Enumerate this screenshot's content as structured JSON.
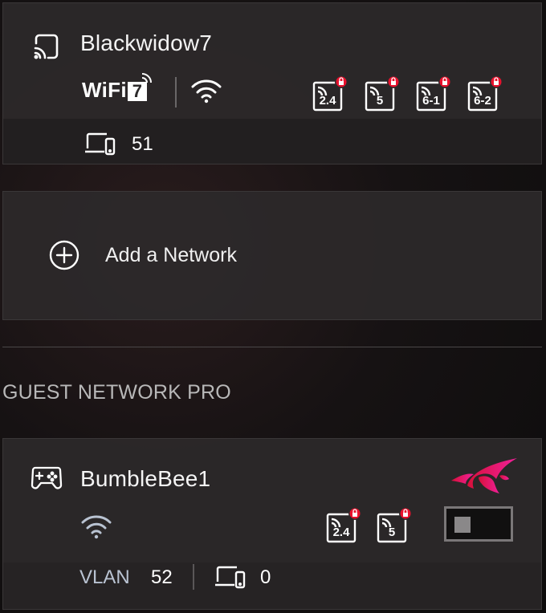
{
  "main_network": {
    "name": "Blackwidow7",
    "wifi_standard_label": "WiFi",
    "wifi_standard_number": "7",
    "bands": [
      "2.4",
      "5",
      "6-1",
      "6-2"
    ],
    "client_count": "51"
  },
  "add_network": {
    "label": "Add a Network"
  },
  "guest_section": {
    "title": "GUEST NETWORK PRO"
  },
  "guest_network": {
    "name": "BumbleBee1",
    "bands": [
      "2.4",
      "5"
    ],
    "vlan_label": "VLAN",
    "vlan_id": "52",
    "client_count": "0",
    "toggle_state": "off"
  },
  "colors": {
    "lock_badge": "#e8112d",
    "rog_logo": "#e8156b",
    "vlan_label": "#b9c3d2"
  },
  "icons": [
    "cast-icon",
    "wifi-icon",
    "band-lock-icon",
    "devices-icon",
    "plus-circle-icon",
    "gamepad-icon",
    "rog-logo-icon"
  ]
}
